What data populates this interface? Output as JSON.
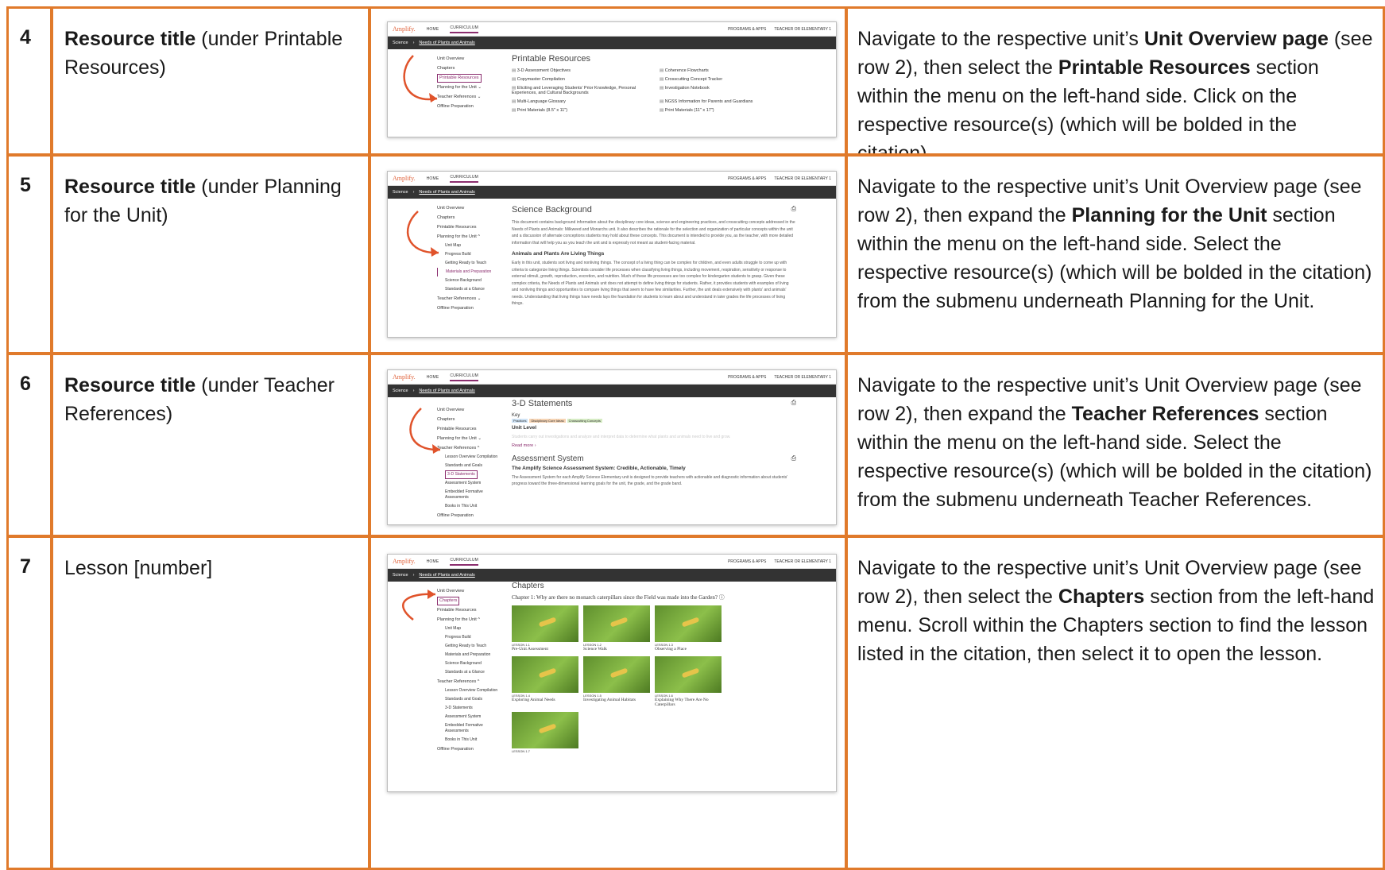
{
  "colors": {
    "border": "#e07a2b",
    "accent": "#8b2d6e",
    "logo": "#e0613a",
    "arrow": "#e0532b"
  },
  "ui": {
    "logo": "Amplify.",
    "nav_home": "HOME",
    "nav_curriculum": "CURRICULUM",
    "programs": "PROGRAMS & APPS",
    "teacher": "TEACHER OR ELEMENTARY 1",
    "crumb_science": "Science",
    "crumb_unit": "Needs of Plants and Animals",
    "menu": {
      "unit_overview": "Unit Overview",
      "chapters": "Chapters",
      "printable": "Printable Resources",
      "planning": "Planning for the Unit",
      "teacher_refs": "Teacher References",
      "offline": "Offline Preparation",
      "unit_map": "Unit Map",
      "progress_build": "Progress Build",
      "getting_ready": "Getting Ready to Teach",
      "materials": "Materials and Preparation",
      "science_background": "Science Background",
      "standards_glance": "Standards at a Glance",
      "lesson_overview": "Lesson Overview Compilation",
      "standards_goals": "Standards and Goals",
      "statements_3d": "3-D Statements",
      "assessment_system": "Assessment System",
      "embedded_formative": "Embedded Formative Assessments",
      "books_unit": "Books in This Unit"
    }
  },
  "rows": [
    {
      "num": "4",
      "title_bold": "Resource title",
      "title_rest": " (under Printable Resources)",
      "desc_html_parts": [
        "Navigate to the respective unit’s ",
        "Unit Overview page",
        " (see row 2), then select the ",
        "Printable Resources",
        " section within the menu on the left-hand side. Click on the respective resource(s) (which will be bolded in the citation)."
      ],
      "shot": {
        "heading": "Printable Resources",
        "items": [
          "3-D Assessment Objectives",
          "Coherence Flowcharts",
          "Copymaster Compilation",
          "Crosscutting Concept Tracker",
          "Eliciting and Leveraging Students’ Prior Knowledge, Personal Experiences, and Cultural Backgrounds",
          "Investigation Notebook",
          "Multi-Language Glossary",
          "NGSS Information for Parents and Guardians",
          "Print Materials (8.5\" x 11\")",
          "Print Materials (11\" x 17\")"
        ]
      }
    },
    {
      "num": "5",
      "title_bold": "Resource title",
      "title_rest": " (under Planning for the Unit)",
      "desc_html_parts": [
        "Navigate to the respective unit’s Unit Overview page (see row 2), then expand the ",
        "Planning for the Unit",
        " section within the menu on the left-hand side. Select the respective resource(s) (which will be bolded in the citation) from the submenu underneath Planning for the Unit.",
        "",
        ""
      ],
      "shot": {
        "heading": "Science Background",
        "para1": "This document contains background information about the disciplinary core ideas, science and engineering practices, and crosscutting concepts addressed in the Needs of Plants and Animals: Milkweed and Monarchs unit. It also describes the rationale for the selection and organization of particular concepts within the unit and a discussion of alternate conceptions students may hold about these concepts. This document is intended to provide you, as the teacher, with more detailed information that will help you as you teach the unit and is expressly not meant as student-facing material.",
        "subhead": "Animals and Plants Are Living Things",
        "para2": "Early in this unit, students sort living and nonliving things. The concept of a living thing can be complex for children, and even adults struggle to come up with criteria to categorize living things. Scientists consider life processes when classifying living things, including movement, respiration, sensitivity or response to external stimuli, growth, reproduction, excretion, and nutrition. Much of these life processes are too complex for kindergarten students to grasp. Given these complex criteria, the Needs of Plants and Animals unit does not attempt to define living things for students. Rather, it provides students with examples of living and nonliving things and opportunities to compare living things that seem to have few similarities. Further, the unit deals extensively with plants' and animals' needs. Understanding that living things have needs lays the foundation for students to learn about and understand in later grades the life processes of living things."
      }
    },
    {
      "num": "6",
      "title_bold": "Resource title",
      "title_rest": " (under Teacher References)",
      "desc_html_parts": [
        "Navigate to the respective unit’s Unit Overview page (see row 2), then expand the ",
        "Teacher References",
        " section within the menu on the left-hand side. Select the respective resource(s) (which will be bolded in the citation) from the submenu underneath Teacher References.",
        "",
        ""
      ],
      "shot": {
        "heading": "3-D Statements",
        "key": "Key",
        "key_items": [
          "Practices",
          "Disciplinary Core Ideas",
          "Crosscutting Concepts"
        ],
        "unit_level": "Unit Level",
        "faded": "Students carry out investigations and analyze and interpret data to determine what plants and animals need to live and grow.",
        "read_more": "Read more ›",
        "heading2": "Assessment System",
        "subhead2": "The Amplify Science Assessment System: Credible, Actionable, Timely",
        "para2": "The Assessment System for each Amplify Science Elementary unit is designed to provide teachers with actionable and diagnostic information about students' progress toward the three-dimensional learning goals for the unit, the grade, and the grade band."
      }
    },
    {
      "num": "7",
      "title_bold": "",
      "title_rest": "Lesson [number]",
      "desc_html_parts": [
        "Navigate to the respective unit’s Unit Overview page (see row 2), then select the ",
        "Chapters",
        " section from the left-hand menu. Scroll within the Chapters section to find the lesson listed in the citation, then select it to open the lesson.",
        "",
        ""
      ],
      "shot": {
        "heading": "Chapters",
        "chapter": "Chapter 1: Why are there no monarch caterpillars since the Field was made into the Garden?",
        "lessons": [
          {
            "label": "LESSON 1.1",
            "name": "Pre-Unit Assessment"
          },
          {
            "label": "LESSON 1.2",
            "name": "Science Walk"
          },
          {
            "label": "LESSON 1.3",
            "name": "Observing a Place"
          },
          {
            "label": "LESSON 1.4",
            "name": "Exploring Animal Needs"
          },
          {
            "label": "LESSON 1.5",
            "name": "Investigating Animal Habitats"
          },
          {
            "label": "LESSON 1.6",
            "name": "Explaining Why There Are No Caterpillars"
          },
          {
            "label": "LESSON 1.7",
            "name": ""
          }
        ]
      }
    }
  ]
}
